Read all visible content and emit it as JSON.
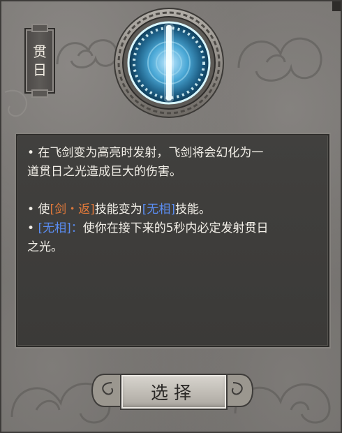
{
  "title": {
    "chars": [
      "贯",
      "日"
    ]
  },
  "emblem": {
    "icon": "sword-of-light-emblem-icon",
    "glow_color": "#8fe6ff"
  },
  "description": {
    "line1": "• 在飞剑变为高亮时发射，飞剑将会幻化为一",
    "line2": "道贯日之光造成巨大的伤害。",
    "p2_prefix": "• 使",
    "p2_skill_a": "[剑・返]",
    "p2_middle": "技能变为",
    "p2_skill_b": "[无相]",
    "p2_suffix": "技能。",
    "p3_prefix": "• ",
    "p3_skill": "[无相]：",
    "p3_text": "使你在接下来的5秒内必定发射贯日",
    "p3_line2": "之光。",
    "colors": {
      "skill_orange": "#e0793a",
      "skill_blue": "#5a8df2"
    }
  },
  "actions": {
    "select_label": "选择"
  }
}
